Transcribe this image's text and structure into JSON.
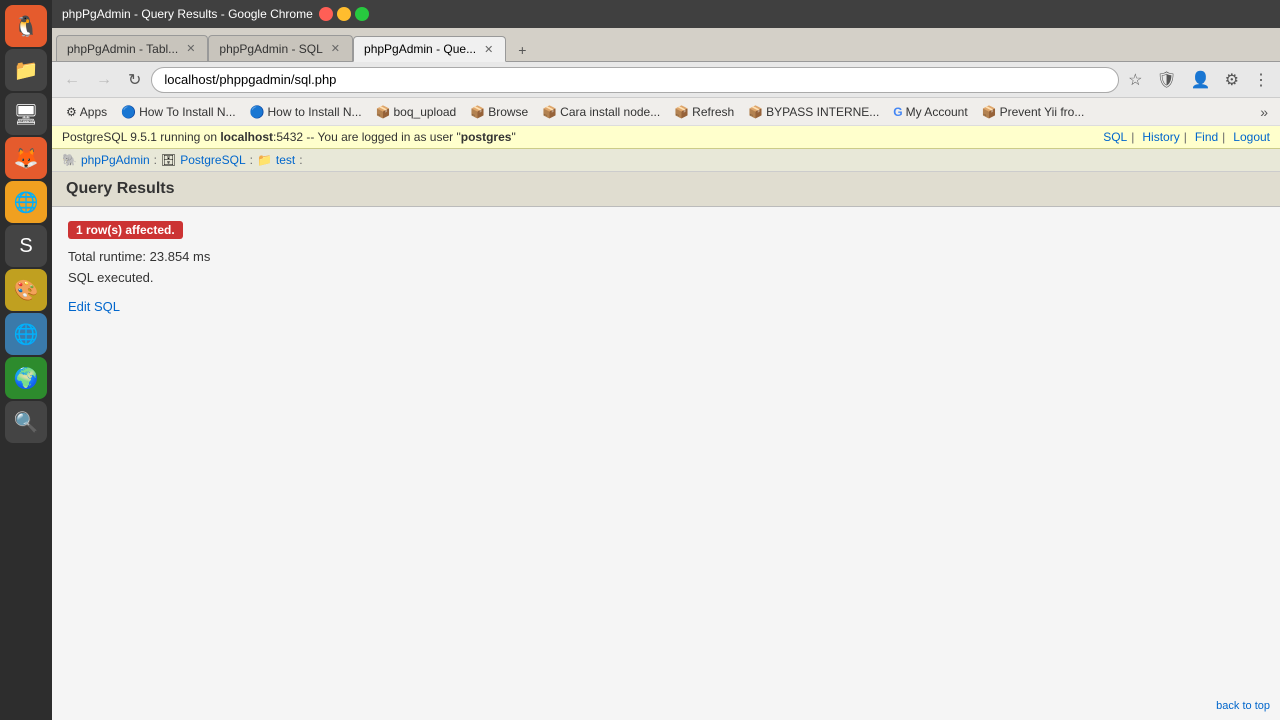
{
  "titlebar": {
    "title": "phpPgAdmin - Query Results - Google Chrome"
  },
  "tabs": [
    {
      "label": "phpPgAdmin - Tabl...",
      "active": false
    },
    {
      "label": "phpPgAdmin - SQL",
      "active": false
    },
    {
      "label": "phpPgAdmin - Que...",
      "active": true
    }
  ],
  "navbar": {
    "address": "localhost/phppgadmin/sql.php"
  },
  "bookmarks": [
    {
      "icon": "⚙",
      "label": "Apps"
    },
    {
      "icon": "🔵",
      "label": "How To Install N..."
    },
    {
      "icon": "🔵",
      "label": "How to Install N..."
    },
    {
      "icon": "📦",
      "label": "boq_upload"
    },
    {
      "icon": "📦",
      "label": "Browse"
    },
    {
      "icon": "📦",
      "label": "Cara install node..."
    },
    {
      "icon": "📦",
      "label": "Refresh"
    },
    {
      "icon": "📦",
      "label": "BYPASS INTERNE..."
    },
    {
      "icon": "G",
      "label": "My Account"
    },
    {
      "icon": "📦",
      "label": "Prevent Yii fro..."
    }
  ],
  "statusbar": {
    "text": "PostgreSQL 9.5.1 running on ",
    "host": "localhost",
    "port": ":5432",
    "message": " -- You are logged in as user \"",
    "user": "postgres",
    "message2": "\"",
    "links": [
      "SQL",
      "History",
      "Find",
      "Logout"
    ]
  },
  "breadcrumb": {
    "items": [
      "phpPgAdmin:",
      "PostgreSQL:",
      "test:"
    ]
  },
  "queryResults": {
    "heading": "Query Results",
    "affected": "1 row(s) affected.",
    "runtime": "Total runtime: 23.854 ms",
    "executed": "SQL executed.",
    "editSql": "Edit SQL"
  },
  "sidebar": {
    "icons": [
      "ubuntu",
      "files",
      "terminal",
      "firefox",
      "chromium",
      "sublime",
      "gimp",
      "browser1",
      "browser2",
      "search"
    ]
  }
}
